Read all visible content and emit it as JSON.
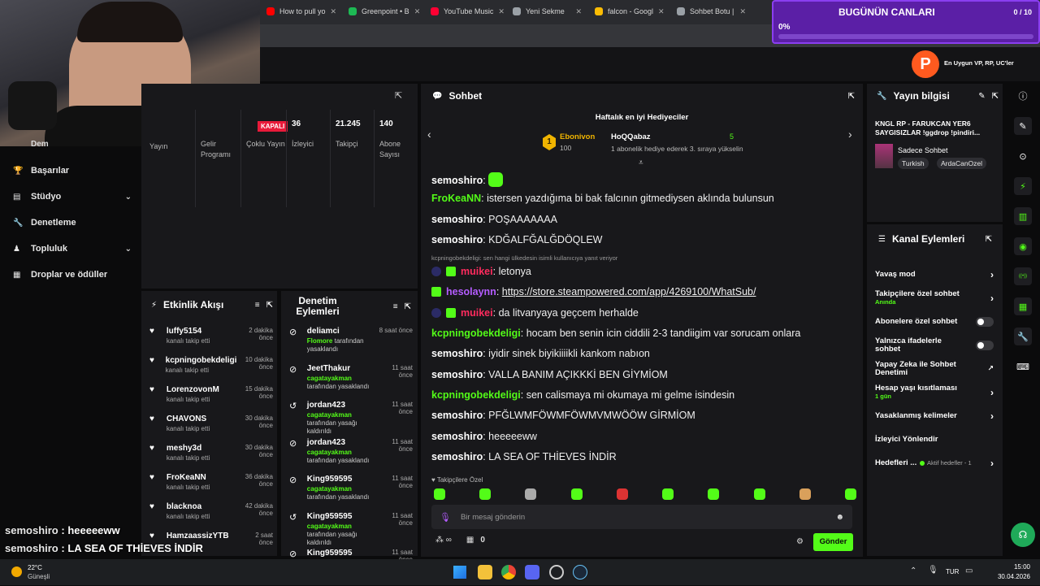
{
  "browser": {
    "tabs": [
      {
        "label": "How to pull yo",
        "color": "#ff0000"
      },
      {
        "label": "Greenpoint • B",
        "color": "#1db954"
      },
      {
        "label": "YouTube Music",
        "color": "#ff0033"
      },
      {
        "label": "Yeni Sekme",
        "color": "#9aa0a6"
      },
      {
        "label": "falcon - Googl",
        "color": "#fbbc04"
      },
      {
        "label": "Sohbet Botu | ",
        "color": "#9aa0a6"
      }
    ]
  },
  "overlay": {
    "goal_title": "BUGÜNÜN CANLARI",
    "goal_count": "0 / 10",
    "goal_percent_label": "0%",
    "goal_progress": 0,
    "sponsor_text": "En Uygun VP, RP, UC'ler"
  },
  "sidebar": {
    "items": [
      {
        "label": "Başarılar",
        "chevron": false
      },
      {
        "label": "Stüdyo",
        "chevron": true
      },
      {
        "label": "Denetleme",
        "chevron": false
      },
      {
        "label": "Topluluk",
        "chevron": true
      },
      {
        "label": "Droplar ve ödüller",
        "chevron": false
      }
    ],
    "partial_top": "Dem"
  },
  "stats": {
    "closed_badge": "KAPALI",
    "cells": [
      {
        "value": "",
        "label": "Gelir Programı"
      },
      {
        "value": "",
        "label": "Çoklu Yayın"
      },
      {
        "value": "36",
        "label": "İzleyici"
      },
      {
        "value": "21.245",
        "label": "Takipçi"
      },
      {
        "value": "140",
        "label": "Abone Sayısı"
      }
    ],
    "partial_label": "Yayın"
  },
  "activity": {
    "title": "Etkinlik Akışı",
    "events": [
      {
        "name": "luffy5154",
        "sub": "kanalı takip etti",
        "time": "2 dakika önce"
      },
      {
        "name": "kcpningobekdeligi",
        "sub": "kanalı takip etti",
        "time": "10 dakika önce"
      },
      {
        "name": "LorenzovonM",
        "sub": "kanalı takip etti",
        "time": "15 dakika önce"
      },
      {
        "name": "CHAVONS",
        "sub": "kanalı takip etti",
        "time": "30 dakika önce"
      },
      {
        "name": "meshy3d",
        "sub": "kanalı takip etti",
        "time": "30 dakika önce"
      },
      {
        "name": "FroKeaNN",
        "sub": "kanalı takip etti",
        "time": "36 dakika önce"
      },
      {
        "name": "blacknoa",
        "sub": "kanalı takip etti",
        "time": "42 dakika önce"
      },
      {
        "name": "HamzaassizYTB",
        "sub": "",
        "time": "2 saat önce"
      }
    ]
  },
  "moderation": {
    "title": "Denetim Eylemleri",
    "actions": [
      {
        "name": "deliamci",
        "by": "Flomore",
        "suffix": "tarafından yasaklandı",
        "time": "8 saat önce",
        "icon": "ban"
      },
      {
        "name": "JeetThakur",
        "by": "cagatayakman",
        "suffix": "tarafından yasaklandı",
        "time": "11 saat önce",
        "icon": "ban"
      },
      {
        "name": "jordan423",
        "by": "cagatayakman",
        "suffix": "tarafından yasağı kaldırıldı",
        "time": "11 saat önce",
        "icon": "undo"
      },
      {
        "name": "jordan423",
        "by": "cagatayakman",
        "suffix": "tarafından yasaklandı",
        "time": "11 saat önce",
        "icon": "ban"
      },
      {
        "name": "King959595",
        "by": "cagatayakman",
        "suffix": "tarafından yasaklandı",
        "time": "11 saat önce",
        "icon": "ban"
      },
      {
        "name": "King959595",
        "by": "cagatayakman",
        "suffix": "tarafından yasağı kaldırıldı",
        "time": "11 saat önce",
        "icon": "undo"
      },
      {
        "name": "King959595",
        "by": "",
        "suffix": "",
        "time": "11 saat önce",
        "icon": "ban"
      }
    ]
  },
  "chat": {
    "title": "Sohbet",
    "gifters_title": "Haftalık en iyi Hediyeciler",
    "gifter1": {
      "rank": "1",
      "name": "Ebonivon",
      "amount": "100"
    },
    "gifter2": {
      "name": "HoQQabaz",
      "amount": "5",
      "note": "1 abonelik hediye ederek 3. sıraya yükselin"
    },
    "reply_context": "kcpningobekdeligi: sen hangi ülkedesin isimli kullanıcıya yanıt veriyor",
    "messages": [
      {
        "user": "semoshiro",
        "color": "#ffffff",
        "text": "",
        "emote": true,
        "badges": 0
      },
      {
        "user": "FroKeaNN",
        "color": "#53fc18",
        "text": "istersen yazdığıma bi bak falcının gitmediysen aklında bulunsun",
        "badges": 0
      },
      {
        "user": "semoshiro",
        "color": "#ffffff",
        "text": "POŞAAAAAAA",
        "badges": 0
      },
      {
        "user": "semoshiro",
        "color": "#ffffff",
        "text": "KDĞALFĞALĞDÖQLEW",
        "badges": 0
      },
      {
        "user": "muikei",
        "color": "#ff2b5e",
        "text": "letonya",
        "badges": 2
      },
      {
        "user": "hesolaynn",
        "color": "#b45cff",
        "text": "https://store.steampowered.com/app/4269100/WhatSub/",
        "badges": 1,
        "link": true
      },
      {
        "user": "muikei",
        "color": "#ff2b5e",
        "text": "da litvanyaya geçcem herhalde",
        "badges": 2
      },
      {
        "user": "kcpningobekdeligi",
        "color": "#53fc18",
        "text": "hocam ben senin icin ciddili 2-3 tandiigim var sorucam onlara",
        "badges": 0
      },
      {
        "user": "semoshiro",
        "color": "#ffffff",
        "text": "iyidir sinek biyikiiiikli kankom nabıon",
        "badges": 0
      },
      {
        "user": "semoshiro",
        "color": "#ffffff",
        "text": "VALLA BANIM AÇIKKKİ BEN GİYMİOM",
        "badges": 0
      },
      {
        "user": "kcpningobekdeligi",
        "color": "#53fc18",
        "text": "sen calismaya mi okumaya mi gelme isindesin",
        "badges": 0
      },
      {
        "user": "semoshiro",
        "color": "#ffffff",
        "text": "PFĞLWMFÖWMFÖWMVMWÖÖW GİRMİOM",
        "badges": 0
      },
      {
        "user": "semoshiro",
        "color": "#ffffff",
        "text": "heeeeeww",
        "badges": 0
      },
      {
        "user": "semoshiro",
        "color": "#ffffff",
        "text": "LA SEA OF THİEVES İNDİR",
        "badges": 0
      }
    ],
    "followers_only": "Takipçilere Özel",
    "input_placeholder": "Bir mesaj gönderin",
    "points": "0",
    "send_label": "Gönder"
  },
  "stream_info": {
    "title": "Yayın bilgisi",
    "stream_title": "KNGL RP - FARUKCAN YER6 SAYGISIZLAR !ggdrop !pindiri...",
    "category": "Sadece Sohbet",
    "tags": [
      "Turkish",
      "ArdaCanOzel"
    ]
  },
  "channel_actions": {
    "title": "Kanal Eylemleri",
    "items": [
      {
        "label": "Yavaş mod",
        "sub": "",
        "control": "chevron"
      },
      {
        "label": "Takipçilere özel sohbet",
        "sub": "Anında",
        "control": "chevron"
      },
      {
        "label": "Abonelere özel sohbet",
        "sub": "",
        "control": "toggle"
      },
      {
        "label": "Yalnızca ifadelerle sohbet",
        "sub": "",
        "control": "toggle"
      },
      {
        "label": "Yapay Zeka ile Sohbet Denetimi",
        "sub": "",
        "control": "external"
      },
      {
        "label": "Hesap yaşı kısıtlaması",
        "sub": "1 gün",
        "control": "chevron"
      },
      {
        "label": "Yasaklanmış kelimeler",
        "sub": "",
        "control": "chevron"
      },
      {
        "label": "İzleyici Yönlendir",
        "sub": "",
        "control": "none"
      },
      {
        "label": "Hedefleri ...",
        "sub": "",
        "control": "chevron",
        "extra": "Aktif hedefler - 1"
      }
    ]
  },
  "overlay_chat": [
    {
      "user": "semoshiro",
      "text": "heeeeeww"
    },
    {
      "user": "semoshiro",
      "text": "LA SEA OF THİEVES İNDİR"
    }
  ],
  "taskbar": {
    "weather_temp": "22°C",
    "weather_desc": "Güneşli",
    "lang": "TUR",
    "time": "15:00",
    "date": "30.04.2026"
  },
  "colors": {
    "accent": "#53fc18",
    "panel": "#18181b",
    "overlay_purple": "#5b1fa6"
  }
}
